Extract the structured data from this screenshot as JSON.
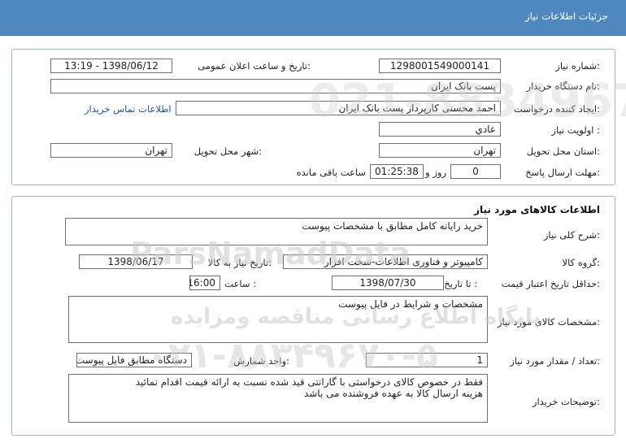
{
  "header": {
    "title": "جزئيات اطلاعات نياز"
  },
  "info": {
    "need_number_label": "شماره نياز:",
    "need_number": "1298001549000141",
    "announce_label": "تاريخ و ساعت اعلان عمومی:",
    "announce_value": "1398/06/12 - 13:19",
    "buyer_org_label": "نام دستگاه خريدار:",
    "buyer_org": "پست بانک ايران",
    "creator_label": "ايجاد کننده درخواست:",
    "creator": "احمد  محسنی کارپرداز پست بانک ايران",
    "contact_link": "اطلاعات تماس خريدار",
    "priority_label": "اولويت نياز :",
    "priority": "عادي",
    "province_label": "استان محل تحويل:",
    "province": "تهران",
    "city_label": "شهر محل تحويل:",
    "city": "تهران",
    "deadline_label": "مهلت ارسال پاسخ:",
    "days_value": "0",
    "days_unit": "روز و",
    "time_value": "01:25:38",
    "time_unit": "ساعت باقی مانده"
  },
  "goods": {
    "title": "اطلاعات کالاهای مورد نياز",
    "summary_label": "شرح کلی نياز:",
    "summary": "خريد رايانه کامل مطابق با مشخصات پيوست",
    "group_label": "گروه کالا:",
    "group": "کامپيوتر و فناوری اطلاعات-سخت افزار",
    "need_date_label": "تاريخ نياز به کالا:",
    "need_date": "1398/06/17",
    "validity_label": "حداقل تاريخ اعتبار قيمت:",
    "until_label": "تا تاريخ :",
    "validity_date": "1398/07/30",
    "hour_label": "ساعت :",
    "validity_time": "16:00",
    "specs_label": "مشخصات کالای مورد نياز:",
    "specs": "مشخصات و شرايط در فايل پيوست",
    "qty_label": "تعداد / مقدار مورد نياز:",
    "qty": "1",
    "unit_label": "واحد شمارش:",
    "unit": "دستگاه مطابق فايل پيوست",
    "notes_label": "توضيحات خريدار:",
    "notes_line1": "فقط در خصوص کالای درخواستی با گارانتی قيد شده نسبت به ارائه قيمت اقدام نمائيد",
    "notes_line2": "هزينه ارسال کالا به عهده فروشنده می باشد"
  },
  "watermark": {
    "brand": "ParsNamadData",
    "line1": "پايگاه اطلاع رسانی مناقصه ومزايده",
    "phone": "۰۲۱-۸۸۳۴۹۶۷۰-۵",
    "number": "021-88349670-5"
  },
  "colors": {
    "header_bg": "#4f88bf",
    "link": "#1f4fb0",
    "border": "#9fb3c9"
  }
}
